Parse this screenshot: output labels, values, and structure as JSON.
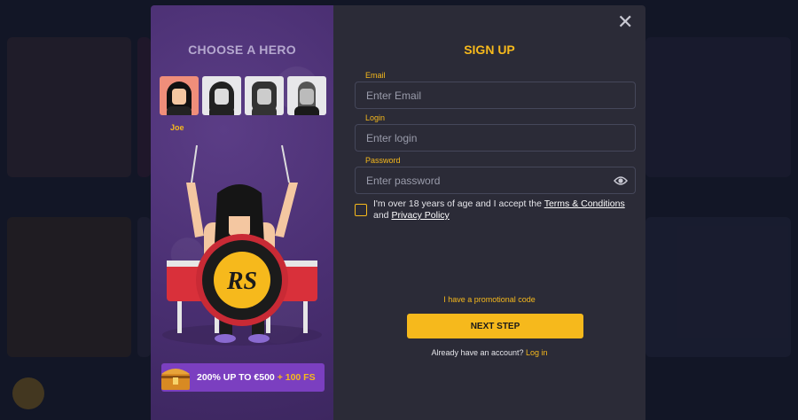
{
  "left": {
    "title": "CHOOSE A HERO",
    "heroes": [
      {
        "name": "Joe",
        "selected": true
      },
      {
        "name": "hero-2",
        "selected": false
      },
      {
        "name": "hero-3",
        "selected": false
      },
      {
        "name": "hero-4",
        "selected": false
      }
    ],
    "selected_hero_label": "Joe",
    "promo": {
      "main": "200% UP TO €500",
      "extra": "+ 100 FS"
    }
  },
  "right": {
    "title": "SIGN UP",
    "email": {
      "label": "Email",
      "placeholder": "Enter Email"
    },
    "login": {
      "label": "Login",
      "placeholder": "Enter login"
    },
    "password": {
      "label": "Password",
      "placeholder": "Enter password"
    },
    "terms": {
      "text": "I'm over 18 years of age and I accept the",
      "terms_link": "Terms & Conditions",
      "and": "and",
      "privacy_link": "Privacy Policy"
    },
    "promo_code": "I have a promotional code",
    "next_button": "NEXT STEP",
    "have_account": "Already have an account?",
    "login_link": "Log in"
  },
  "colors": {
    "accent": "#f6b91c",
    "panel": "#2b2b37",
    "purple": "#4a2f72"
  }
}
